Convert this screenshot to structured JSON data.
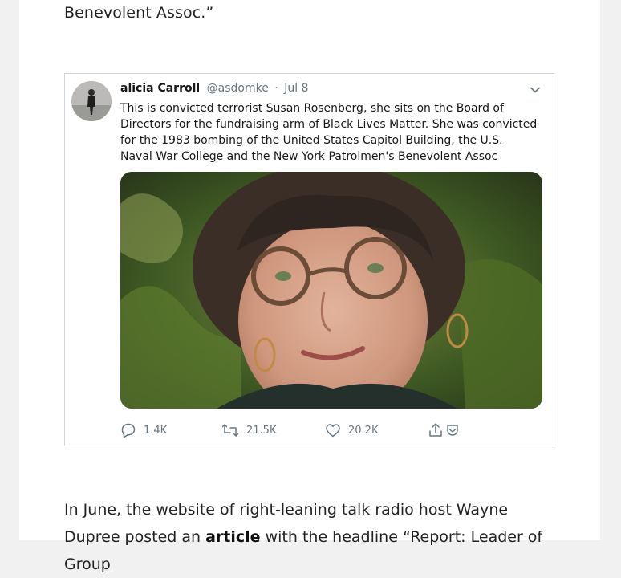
{
  "previous_paragraph_tail": "Benevolent Assoc.”",
  "tweet": {
    "author_name": "alicia Carroll",
    "author_handle": "@asdomke",
    "separator": "·",
    "date": "Jul 8",
    "text": "This is convicted terrorist Susan Rosenberg, she sits on the Board of Directors for the fundraising arm of Black Lives Matter.  She was convicted for the 1983 bombing of the United States Capitol Building, the U.S. Naval War College and the New York Patrolmen's Benevolent Assoc",
    "actions": {
      "replies": "1.4K",
      "retweets": "21.5K",
      "likes": "20.2K"
    },
    "icons": [
      "chevron-down-icon",
      "reply-icon",
      "retweet-icon",
      "like-icon",
      "share-icon",
      "save-icon"
    ]
  },
  "next_paragraph": {
    "text_before": "In June, the website of right-leaning talk radio host Wayne Dupree posted an",
    "link_text": "article",
    "text_after": "with the headline “Report: Leader of Group"
  },
  "colors": {
    "page_background": "#f1f1f2",
    "card_background": "#ffffff",
    "tweet_border": "#cfd5da",
    "muted_text": "#66757f"
  }
}
